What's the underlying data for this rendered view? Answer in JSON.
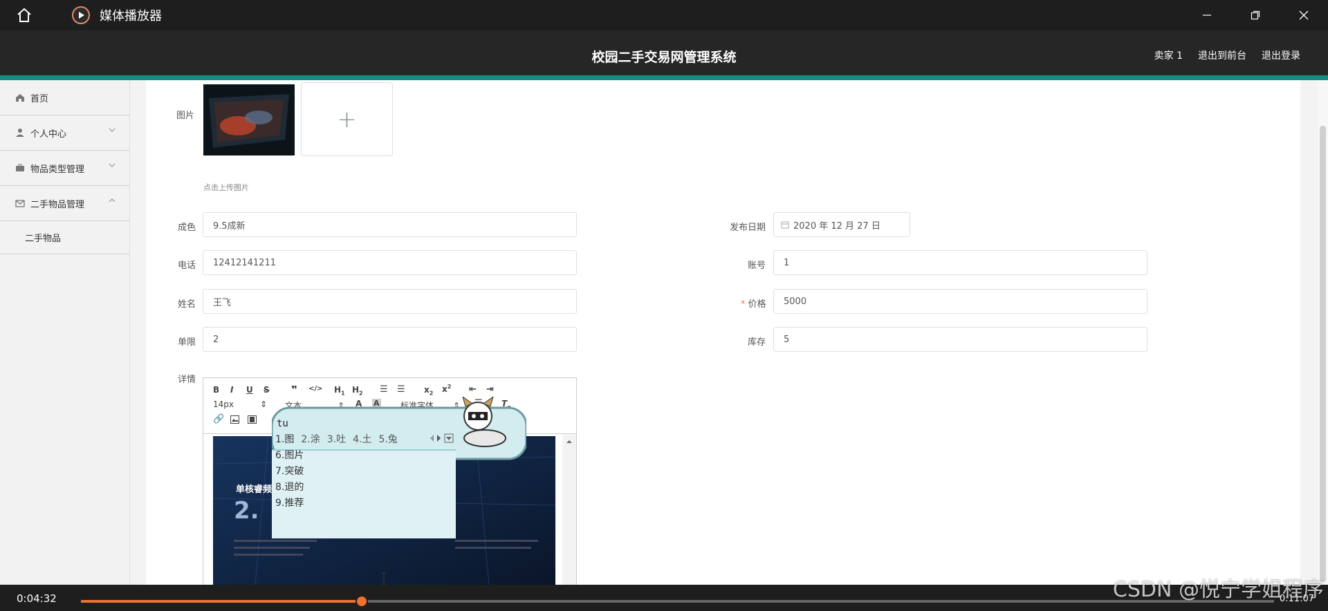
{
  "window": {
    "app_title": "媒体播放器"
  },
  "header": {
    "system_title": "校园二手交易网管理系统",
    "user": "卖家 1",
    "front_link": "退出到前台",
    "logout_link": "退出登录"
  },
  "sidebar": {
    "items": [
      {
        "label": "首页",
        "icon": "home-icon"
      },
      {
        "label": "个人中心",
        "icon": "user-icon"
      },
      {
        "label": "物品类型管理",
        "icon": "briefcase-icon"
      },
      {
        "label": "二手物品管理",
        "icon": "mail-icon"
      }
    ],
    "sub_item": "二手物品"
  },
  "form": {
    "image_label": "图片",
    "upload_hint": "点击上传图片",
    "upload_plus": "+",
    "condition_label": "成色",
    "condition_value": "9.5成新",
    "date_label": "发布日期",
    "date_value": "2020 年 12 月 27 日",
    "phone_label": "电话",
    "phone_value": "12412141211",
    "account_label": "账号",
    "account_value": "1",
    "name_label": "姓名",
    "name_value": "王飞",
    "price_req": "*",
    "price_label": "价格",
    "price_value": "5000",
    "limit_label": "单限",
    "limit_value": "2",
    "stock_label": "库存",
    "stock_value": "5",
    "detail_label": "详情"
  },
  "editor": {
    "font_size": "14px",
    "para_format": "文本",
    "font_family": "标准字体",
    "image_text": "单核睿频至高可达",
    "image_num": "2."
  },
  "ime": {
    "input": "tu",
    "row1": [
      "1.图",
      "2.涂",
      "3.吐",
      "4.土",
      "5.兔"
    ],
    "list": [
      "6.图片",
      "7.突破",
      "8.退的",
      "9.推荐"
    ]
  },
  "player": {
    "elapsed": "0:04:32",
    "total": "0:11:07",
    "progress": 0.2353
  },
  "watermark": "CSDN @悦宁学姐程序",
  "colors": {
    "accent_teal": "#178c84",
    "progress": "#f07030",
    "titlebar": "#1e1e1e"
  }
}
